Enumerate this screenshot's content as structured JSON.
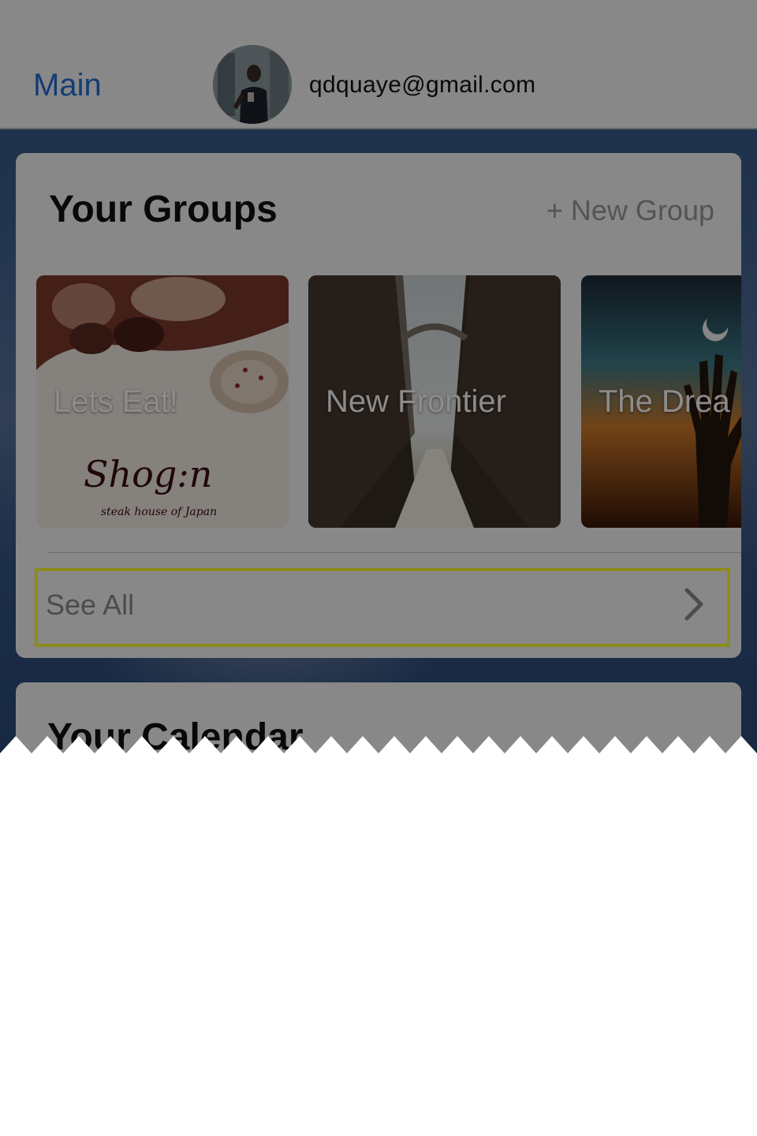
{
  "nav": {
    "back_label": "Main",
    "email": "qdquaye@gmail.com"
  },
  "groups": {
    "title": "Your Groups",
    "new_group_label": "+ New Group",
    "tiles": [
      {
        "label": "Lets Eat!",
        "logo_text": "Shog:n",
        "logo_subtext": "steak house of Japan"
      },
      {
        "label": "New Frontier"
      },
      {
        "label": "The Drea"
      }
    ],
    "see_all_label": "See All"
  },
  "calendar": {
    "title": "Your Calendar"
  },
  "colors": {
    "nav_link": "#1f6fd6",
    "highlight": "#ffff33",
    "background": "#3f618f"
  }
}
